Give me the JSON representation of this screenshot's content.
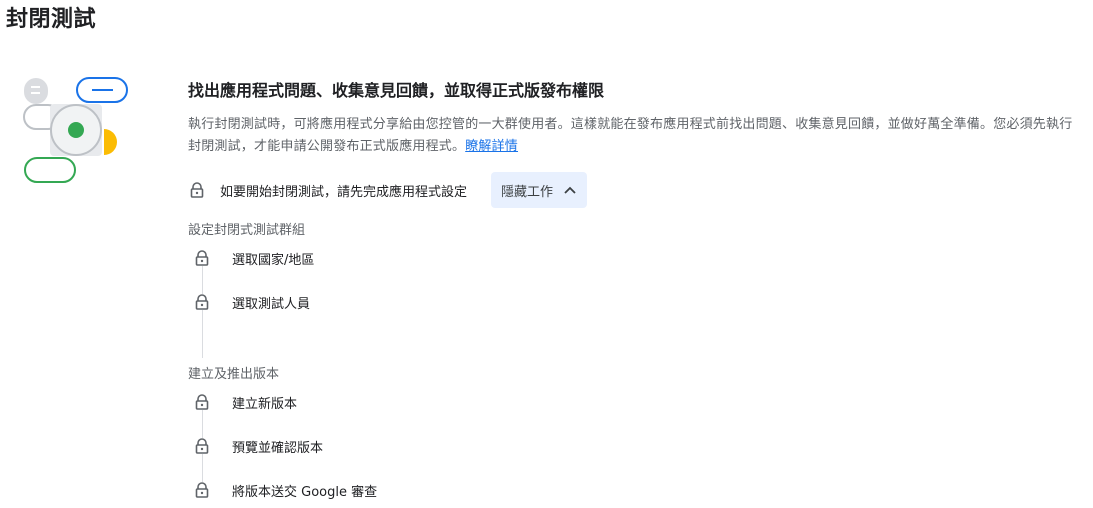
{
  "page": {
    "title": "封閉測試"
  },
  "intro": {
    "headline": "找出應用程式問題、收集意見回饋，並取得正式版發布權限",
    "description": "執行封閉測試時，可將應用程式分享給由您控管的一大群使用者。這樣就能在發布應用程式前找出問題、收集意見回饋，並做好萬全準備。您必須先執行封閉測試，才能申請公開發布正式版應用程式。",
    "learn_more": "瞭解詳情"
  },
  "prerequisite": {
    "text": "如要開始封閉測試，請先完成應用程式設定",
    "hide_button_label": "隱藏工作"
  },
  "sections": [
    {
      "label": "設定封閉式測試群組",
      "steps": [
        {
          "label": "選取國家/地區",
          "icon": "lock-icon"
        },
        {
          "label": "選取測試人員",
          "icon": "lock-icon"
        }
      ]
    },
    {
      "label": "建立及推出版本",
      "steps": [
        {
          "label": "建立新版本",
          "icon": "lock-icon"
        },
        {
          "label": "預覽並確認版本",
          "icon": "lock-icon"
        },
        {
          "label": "將版本送交 Google 審查",
          "icon": "lock-icon"
        }
      ]
    }
  ],
  "colors": {
    "accent_blue": "#1a73e8",
    "green": "#34a853",
    "yellow": "#fbbc04",
    "button_bg": "#e8f0fe"
  }
}
